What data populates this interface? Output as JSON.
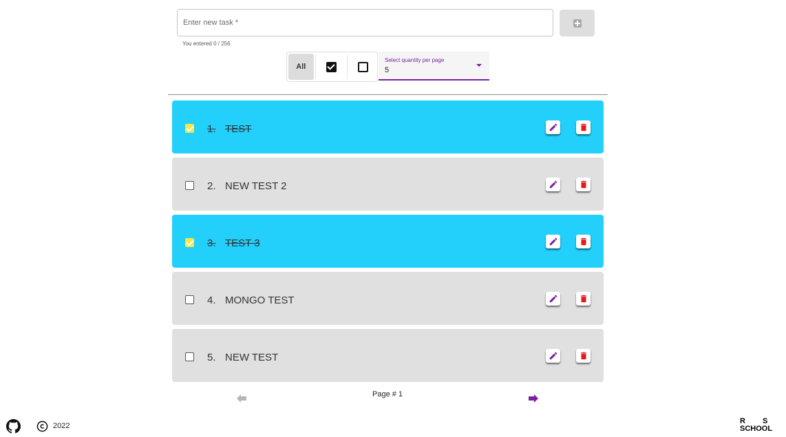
{
  "task_form": {
    "placeholder": "Enter new task *",
    "helper_text": "You entered 0 / 256",
    "add_icon": "add-box-icon"
  },
  "filters": {
    "all_label": "All",
    "completed_icon": "checked-box-icon",
    "active_icon": "empty-box-icon",
    "selected": "All"
  },
  "page_size": {
    "label": "Select quantity per page",
    "value": "5",
    "accent_color": "#7b1fa2"
  },
  "tasks": [
    {
      "number": "1.",
      "text": "TEST",
      "completed": true
    },
    {
      "number": "2.",
      "text": "NEW TEST 2",
      "completed": false
    },
    {
      "number": "3.",
      "text": "TEST 3",
      "completed": true
    },
    {
      "number": "4.",
      "text": "MONGO TEST",
      "completed": false
    },
    {
      "number": "5.",
      "text": "NEW TEST",
      "completed": false
    }
  ],
  "task_colors": {
    "completed_bg": "#22d0fb",
    "active_bg": "#e0e0e0",
    "edit_icon": "#7b1fa2",
    "delete_icon": "#e31b1b"
  },
  "pagination": {
    "page_label": "Page # 1",
    "prev_icon": "arrow-left-icon",
    "next_icon": "arrow-right-icon",
    "prev_enabled": false,
    "next_enabled": true
  },
  "footer": {
    "github_icon": "github-icon",
    "copyright_icon": "copyright-icon",
    "year": "2022",
    "logo_text": [
      "R",
      "S",
      "SCHOOL"
    ]
  }
}
